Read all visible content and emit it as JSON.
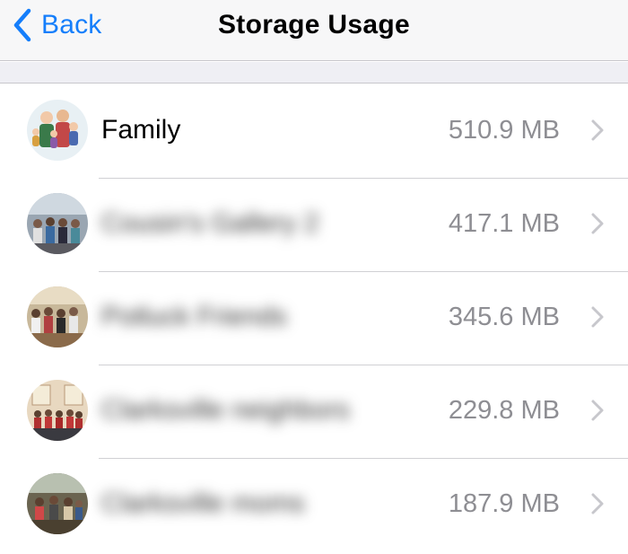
{
  "nav": {
    "back_label": "Back",
    "title": "Storage Usage",
    "back_icon": "chevron-left-icon",
    "accent_color": "#157efb"
  },
  "chats": [
    {
      "name": "Family",
      "size": "510.9 MB",
      "name_blurred": false
    },
    {
      "name": "Cousin's Gallery 2",
      "size": "417.1 MB",
      "name_blurred": true
    },
    {
      "name": "Potluck Friends",
      "size": "345.6 MB",
      "name_blurred": true
    },
    {
      "name": "Clarksville neighbors",
      "size": "229.8 MB",
      "name_blurred": true
    },
    {
      "name": "Clarksville moms",
      "size": "187.9 MB",
      "name_blurred": true
    }
  ],
  "disclosure_icon": "chevron-right-icon",
  "colors": {
    "nav_background": "#f7f7f8",
    "group_background": "#efeff4",
    "secondary_text": "#8e8e93",
    "separator": "#c8c7cc"
  }
}
